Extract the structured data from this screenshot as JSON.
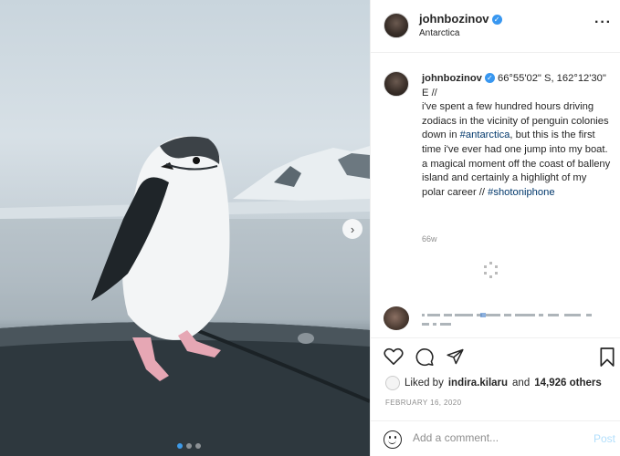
{
  "post": {
    "username": "johnbozinov",
    "location": "Antarctica",
    "caption_coords": "66°55'02\" S, 162°12'30\" E //",
    "caption_text_1": "i've spent a few hundred hours driving zodiacs in the vicinity of penguin colonies down in",
    "hashtag_1": "#antarctica",
    "caption_text_2": ", but this is the first time i've ever had one jump into my boat. a magical moment off the coast of balleny island and certainly a highlight of my polar career //",
    "hashtag_2": "#shotoniphone",
    "time_ago": "66w",
    "liked_by_prefix": "Liked by",
    "liked_by_user": "indira.kilaru",
    "liked_by_and": "and",
    "likes_count": "14,926 others",
    "date": "FEBRUARY 16, 2020"
  },
  "carousel": {
    "slide_count": 3,
    "active_index": 0
  },
  "comment_box": {
    "placeholder": "Add a comment...",
    "post_label": "Post"
  },
  "icons": {
    "like": "heart-icon",
    "comment": "comment-icon",
    "share": "share-icon",
    "save": "bookmark-icon",
    "more": "more-options-icon",
    "next": "chevron-right-icon",
    "emoji": "emoji-icon",
    "verified": "verified-badge-icon"
  },
  "colors": {
    "link": "#00376b",
    "verified": "#3897f0",
    "post_disabled": "#b2dffc",
    "muted": "#8e8e8e"
  }
}
